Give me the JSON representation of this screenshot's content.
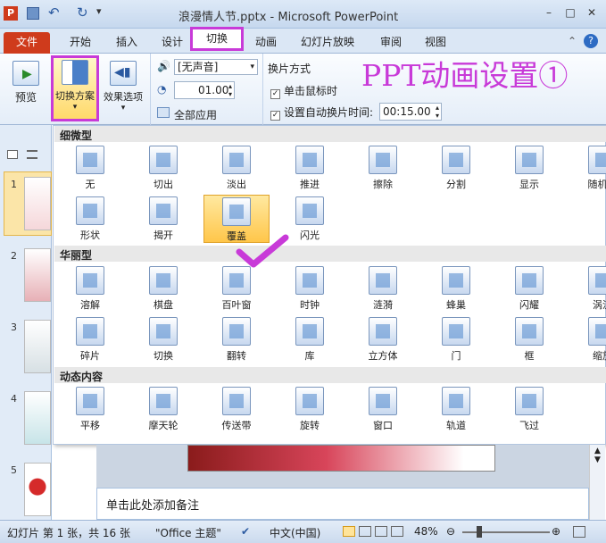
{
  "app": {
    "title": "浪漫情人节.pptx - Microsoft PowerPoint"
  },
  "window_controls": {
    "minimize": "–",
    "maximize": "□",
    "close": "✕"
  },
  "tabs": [
    "开始",
    "插入",
    "设计",
    "切换",
    "动画",
    "幻灯片放映",
    "审阅",
    "视图"
  ],
  "file_tab": "文件",
  "ribbon": {
    "preview_label": "预览",
    "preview_group": "预览",
    "scheme_label": "切换方案",
    "effects_label": "效果选项",
    "sound_value": "[无声音]",
    "duration_value": "01.00",
    "apply_all": "全部应用",
    "advance_title": "换片方式",
    "on_click": "单击鼠标时",
    "after_time": "设置自动换片时间:",
    "after_time_value": "00:15.00"
  },
  "overlay_text": "PPT动画设置①",
  "gallery": {
    "sections": [
      {
        "title": "细微型",
        "rows": [
          [
            "无",
            "切出",
            "淡出",
            "推进",
            "擦除",
            "分割",
            "显示",
            "随机线"
          ],
          [
            "形状",
            "揭开",
            "覆盖",
            "闪光"
          ]
        ]
      },
      {
        "title": "华丽型",
        "rows": [
          [
            "溶解",
            "棋盘",
            "百叶窗",
            "时钟",
            "涟漪",
            "蜂巢",
            "闪耀",
            "涡流"
          ],
          [
            "碎片",
            "切换",
            "翻转",
            "库",
            "立方体",
            "门",
            "框",
            "缩放"
          ]
        ]
      },
      {
        "title": "动态内容",
        "rows": [
          [
            "平移",
            "摩天轮",
            "传送带",
            "旋转",
            "窗口",
            "轨道",
            "飞过"
          ]
        ]
      }
    ],
    "selected": "覆盖"
  },
  "thumbnails": [
    "1",
    "2",
    "3",
    "4",
    "5"
  ],
  "notes_placeholder": "单击此处添加备注",
  "status": {
    "slide_info": "幻灯片 第 1 张，共 16 张",
    "theme": "\"Office 主题\"",
    "language": "中文(中国)",
    "zoom": "48%"
  },
  "colors": {
    "accent": "#c83ad8",
    "file_tab": "#cf3b1c"
  }
}
